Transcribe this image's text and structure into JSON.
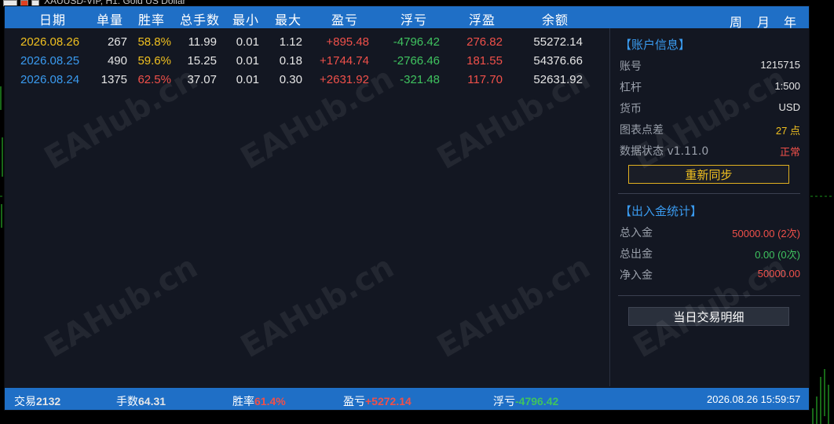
{
  "chart": {
    "title": "XAUUSD-VIP, H1:  Gold US Dollar"
  },
  "colors": {
    "header_bg": "#1f6fc6",
    "panel_bg": "#131722",
    "profit": "#f0504a",
    "loss": "#3fc35f",
    "gold": "#f0c020",
    "blue_text": "#3a9bf0",
    "grey_text": "#9aa0ab"
  },
  "header": {
    "columns": [
      "日期",
      "单量",
      "胜率",
      "总手数",
      "最小",
      "最大",
      "盈亏",
      "浮亏",
      "浮盈",
      "余额"
    ],
    "periods": [
      "周",
      "月",
      "年"
    ]
  },
  "rows": [
    {
      "date": "2026.08.26",
      "orders": "267",
      "winrate": "58.8%",
      "lots": "11.99",
      "min": "0.01",
      "max": "1.12",
      "pnl": "+895.48",
      "float_loss": "-4796.42",
      "float_profit": "276.82",
      "balance": "55272.14",
      "date_color": "#f0c020",
      "winrate_color": "#f0c020"
    },
    {
      "date": "2026.08.25",
      "orders": "490",
      "winrate": "59.6%",
      "lots": "15.25",
      "min": "0.01",
      "max": "0.18",
      "pnl": "+1744.74",
      "float_loss": "-2766.46",
      "float_profit": "181.55",
      "balance": "54376.66",
      "date_color": "#3a9bf0",
      "winrate_color": "#f0c020"
    },
    {
      "date": "2026.08.24",
      "orders": "1375",
      "winrate": "62.5%",
      "lots": "37.07",
      "min": "0.01",
      "max": "0.30",
      "pnl": "+2631.92",
      "float_loss": "-321.48",
      "float_profit": "117.70",
      "balance": "52631.92",
      "date_color": "#3a9bf0",
      "winrate_color": "#f0504a"
    }
  ],
  "account": {
    "title": "【账户信息】",
    "items": [
      {
        "label": "账号",
        "value": "1215715",
        "color": "#e6e6e6"
      },
      {
        "label": "杠杆",
        "value": "1:500",
        "color": "#e6e6e6"
      },
      {
        "label": "货币",
        "value": "USD",
        "color": "#e6e6e6"
      },
      {
        "label": "图表点差",
        "value": "27 点",
        "color": "#f0c020"
      },
      {
        "label": "数据状态 v1.11.0",
        "value": "正常",
        "color": "#f0504a"
      }
    ],
    "sync_button": "重新同步"
  },
  "funds": {
    "title": "【出入金统计】",
    "items": [
      {
        "label": "总入金",
        "value": "50000.00 (2次)",
        "color": "#f0504a"
      },
      {
        "label": "总出金",
        "value": "0.00 (0次)",
        "color": "#3fc35f"
      },
      {
        "label": "净入金",
        "value": "50000.00",
        "color": "#f0504a"
      }
    ],
    "detail_button": "当日交易明细"
  },
  "footer": {
    "trades_label": "交易",
    "trades_value": "2132",
    "lots_label": "手数",
    "lots_value": "64.31",
    "winrate_label": "胜率",
    "winrate_value": "61.4%",
    "pnl_label": "盈亏",
    "pnl_value": "+5272.14",
    "float_label": "浮亏",
    "float_value": "-4796.42",
    "datetime": "2026.08.26 15:59:57"
  },
  "watermark": "EAHub.cn"
}
